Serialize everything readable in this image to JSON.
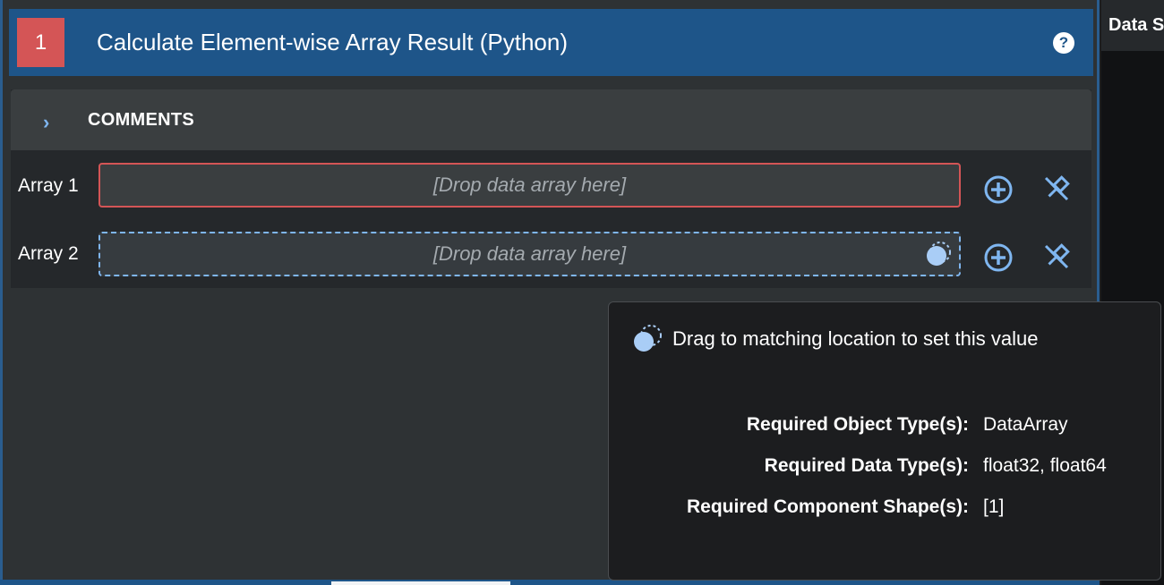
{
  "filter": {
    "index": "1",
    "title": "Calculate Element-wise Array Result (Python)",
    "help_icon": "help-question-icon"
  },
  "comments": {
    "label": "COMMENTS",
    "expanded": false
  },
  "parameters": [
    {
      "label": "Array 1",
      "placeholder": "[Drop data array here]",
      "state": "error"
    },
    {
      "label": "Array 2",
      "placeholder": "[Drop data array here]",
      "state": "drag-target"
    }
  ],
  "side_panel": {
    "tab_label": "Data S"
  },
  "tooltip": {
    "message": "Drag to matching location to set this value",
    "rows": [
      {
        "key": "Required Object Type(s):",
        "value": "DataArray"
      },
      {
        "key": "Required Data Type(s):",
        "value": "float32, float64"
      },
      {
        "key": "Required Component Shape(s):",
        "value": "[1]"
      }
    ]
  },
  "colors": {
    "header_blue": "#1e5589",
    "badge_red": "#d45556",
    "accent_blue": "#7fb6f0",
    "error_red": "#d45556"
  }
}
